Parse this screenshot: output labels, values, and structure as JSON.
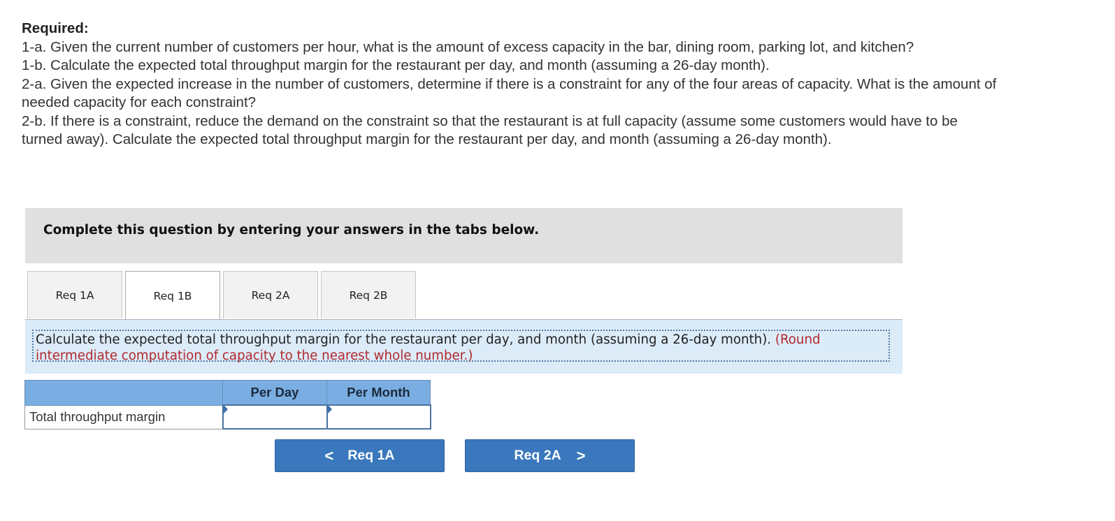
{
  "required": {
    "title": "Required:",
    "items": [
      "1-a. Given the current number of customers per hour, what is the amount of excess capacity in the bar, dining room, parking lot, and kitchen?",
      "1-b. Calculate the expected total throughput margin for the restaurant per day, and month (assuming a 26-day month).",
      "2-a. Given the expected increase in the number of customers, determine if there is a constraint for any of the four areas of capacity. What is the amount of needed capacity for each constraint?",
      "2-b. If there is a constraint, reduce the demand on the constraint so that the restaurant is at full capacity (assume some customers would have to be turned away). Calculate the expected total throughput margin for the restaurant per day, and month (assuming a 26-day month)."
    ]
  },
  "instruction": "Complete this question by entering your answers in the tabs below.",
  "tabs": [
    {
      "label": "Req 1A",
      "active": false
    },
    {
      "label": "Req 1B",
      "active": true
    },
    {
      "label": "Req 2A",
      "active": false
    },
    {
      "label": "Req 2B",
      "active": false
    }
  ],
  "prompt": {
    "text": "Calculate the expected total throughput margin for the restaurant per day, and month (assuming a 26-day month).",
    "note": "(Round intermediate computation of capacity to the nearest whole number.)"
  },
  "table": {
    "headers": [
      "",
      "Per Day",
      "Per Month"
    ],
    "rows": [
      {
        "label": "Total throughput margin",
        "per_day": "",
        "per_month": ""
      }
    ]
  },
  "navigation": {
    "prev_label": "Req 1A",
    "next_label": "Req 2A",
    "prev_icon": "chevron-left-icon",
    "next_icon": "chevron-right-icon",
    "prev_glyph": "<",
    "next_glyph": ">"
  },
  "colors": {
    "accent_button": "#3a77bd",
    "table_header": "#7aaee3",
    "prompt_panel": "#dcebf8",
    "note_red": "#b0282c",
    "instruction_bg": "#e0e0e0"
  }
}
